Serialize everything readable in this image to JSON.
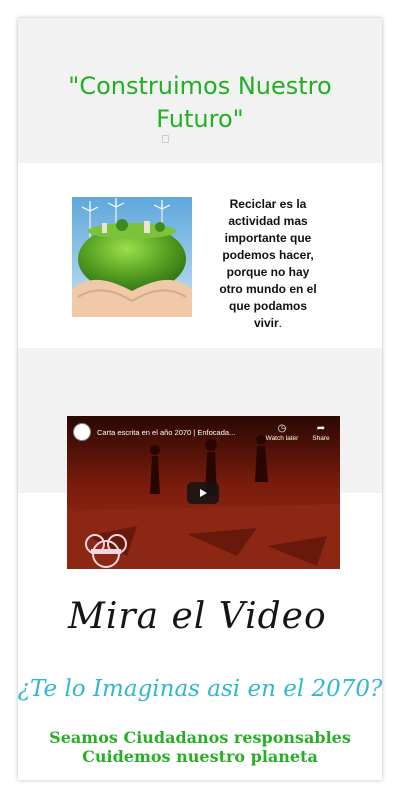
{
  "hero": {
    "title": "\"Construimos Nuestro Futuro\"",
    "background_color": "#f2f2f2",
    "title_color": "#22b022"
  },
  "recycle": {
    "image_icon": "globe-in-hands-image",
    "text": "Reciclar es la actividad mas importante que podemos hacer, porque no hay otro mundo en el que podamos vivir",
    "text_end": "."
  },
  "video": {
    "title": "Carta escrita en el año 2070 | Enfocada...",
    "watch_later_label": "Watch later",
    "share_label": "Share",
    "watch_later_icon": "clock-icon",
    "share_icon": "share-arrow-icon",
    "play_icon": "play-icon"
  },
  "mira": {
    "label": "Mira el Video"
  },
  "imagine": {
    "text": "¿Te lo Imaginas asi en el 2070?",
    "color": "#2fb8cf"
  },
  "closing": {
    "line1": "Seamos Ciudadanos responsables",
    "line2": "Cuidemos nuestro planeta",
    "color": "#27b027"
  }
}
